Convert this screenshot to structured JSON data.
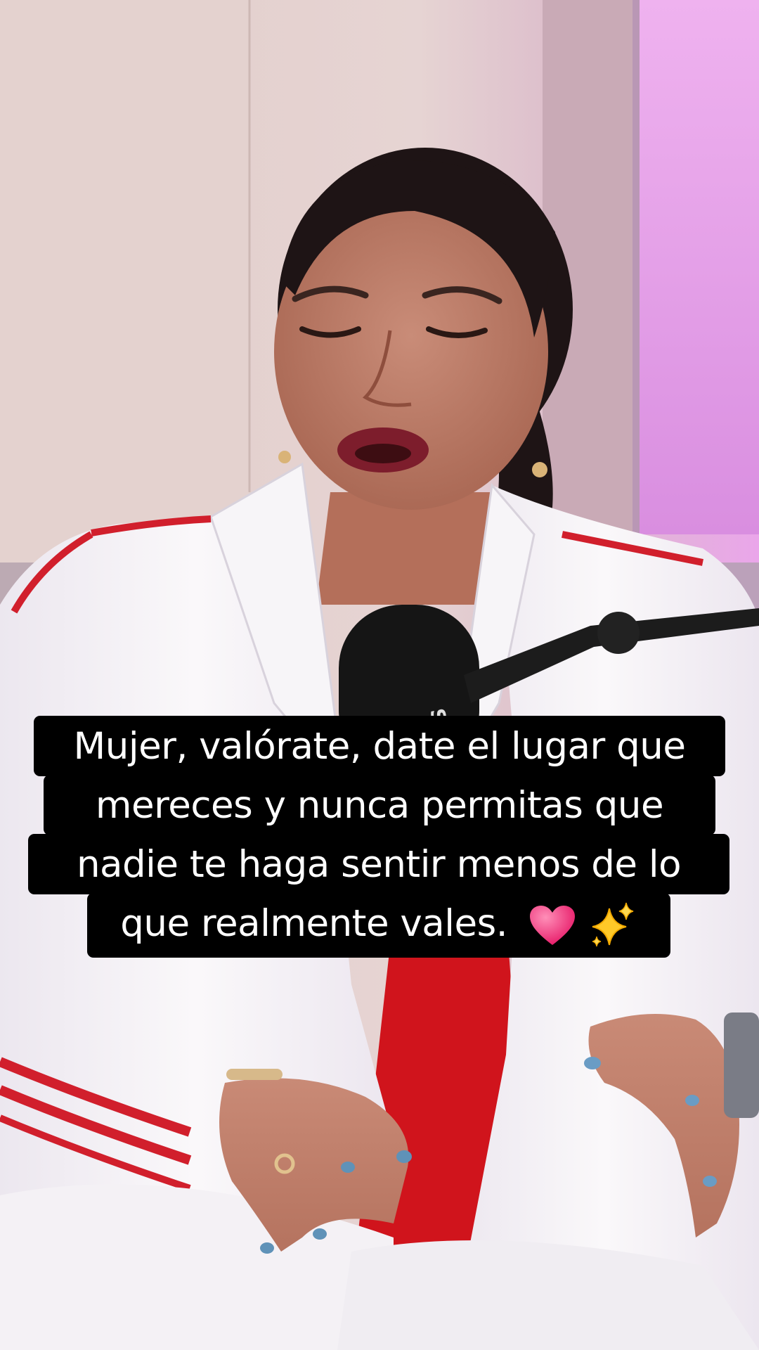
{
  "caption": {
    "line1": "Mujer, valórate, date el lugar que",
    "line2": "mereces y nunca permitas que",
    "line3": "nadie te haga sentir menos de lo",
    "line4": "que realmente vales."
  },
  "icons": {
    "emoji1": "heart-icon",
    "emoji2": "sparkles-icon"
  },
  "microphone": {
    "brand": "SHURE"
  },
  "colors": {
    "caption_bg": "#000000",
    "caption_text": "#ffffff",
    "heart": "#f2357c",
    "sparkles": "#ffcc2b",
    "jacket": "#f6f3f6",
    "jacket_stripe": "#d11f2c",
    "backdrop_pink": "#e9a6ea"
  }
}
